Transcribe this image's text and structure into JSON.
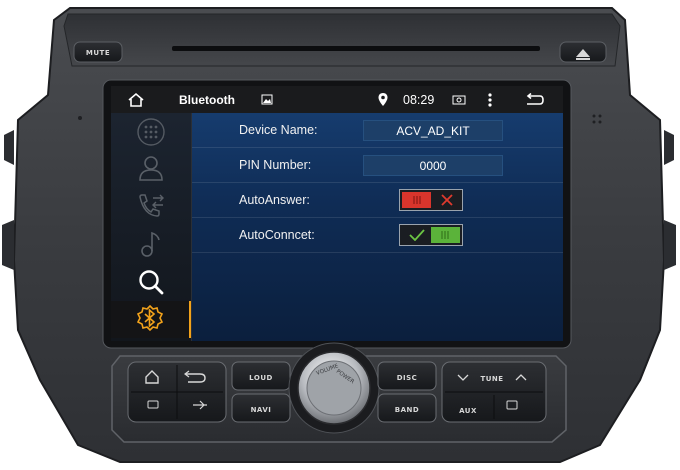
{
  "hardware": {
    "mute_label": "MUTE",
    "loud_label": "LOUD",
    "navi_label": "NAVI",
    "disc_label": "DISC",
    "band_label": "BAND",
    "tune_label": "TUNE",
    "aux_label": "AUX",
    "knob_text_left": "VOLUME",
    "knob_text_right": "POWER"
  },
  "statusbar": {
    "title": "Bluetooth",
    "time": "08:29"
  },
  "sidebar": {
    "items": [
      {
        "icon": "dialpad-icon",
        "active": false
      },
      {
        "icon": "contacts-icon",
        "active": false
      },
      {
        "icon": "call-log-icon",
        "active": false
      },
      {
        "icon": "music-icon",
        "active": false
      },
      {
        "icon": "search-icon",
        "active": false
      },
      {
        "icon": "bluetooth-settings-icon",
        "active": true
      }
    ]
  },
  "settings": {
    "device_name": {
      "label": "Device Name:",
      "value": "ACV_AD_KIT"
    },
    "pin_number": {
      "label": "PIN Number:",
      "value": "0000"
    },
    "auto_answer": {
      "label": "AutoAnswer:",
      "state": "off"
    },
    "auto_connect": {
      "label": "AutoConncet:",
      "state": "on"
    }
  },
  "colors": {
    "accent": "#f2a21b",
    "toggle_off": "#d9352c",
    "toggle_on": "#5bb33a",
    "panel_blue": "#163c6e"
  }
}
